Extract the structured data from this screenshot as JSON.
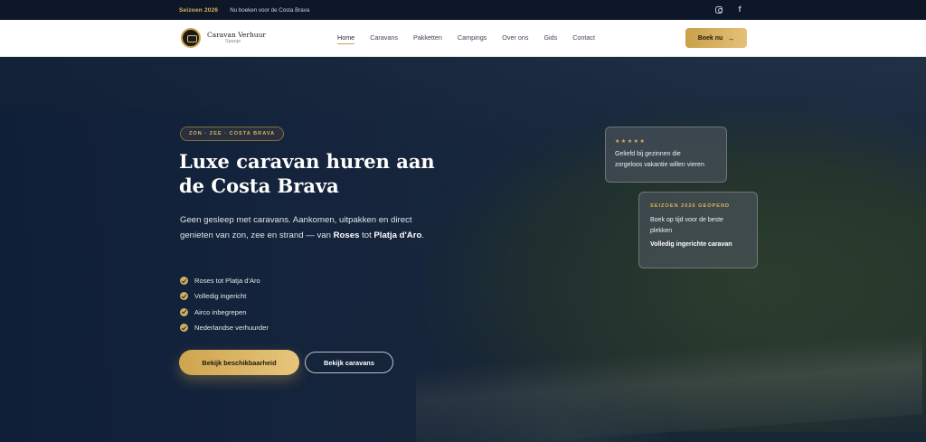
{
  "topbar": {
    "season": "Seizoen 2026",
    "notice": "Nu boeken voor de Costa Brava",
    "social": [
      {
        "icon": "instagram-icon"
      },
      {
        "icon": "facebook-icon",
        "glyph": "f"
      }
    ]
  },
  "header": {
    "logo": {
      "name": "Caravan Verhuur",
      "sub": "Spanje"
    },
    "nav": [
      "Home",
      "Caravans",
      "Pakketten",
      "Campings",
      "Over ons",
      "Gids",
      "Contact"
    ],
    "active_nav": "Home",
    "book_button": "Boek nu",
    "book_arrow": "→"
  },
  "hero": {
    "tag": "ZON · ZEE · COSTA BRAVA",
    "title": "Luxe caravan huren aan de Costa Brava",
    "intro_part1": "Geen gesleep met caravans. Aankomen, uitpakken en direct genieten van zon, zee en strand — van ",
    "intro_bold1": "Roses",
    "intro_part2": " tot ",
    "intro_bold2": "Platja d'Aro",
    "intro_part3": ".",
    "features": [
      "Roses tot Platja d'Aro",
      "Volledig ingericht",
      "Airco inbegrepen",
      "Nederlandse verhuurder"
    ],
    "primary_button": "Bekijk beschikbaarheid",
    "secondary_button": "Bekijk caravans"
  },
  "cards": {
    "review": {
      "stars": "★★★★★",
      "text": "Geliefd bij gezinnen die zorgeloos vakantie willen vieren"
    },
    "season": {
      "label": "SEIZOEN 2026 GEOPEND",
      "text": "Boek op tijd voor de beste plekken",
      "strong": "Volledig ingerichte caravan"
    }
  },
  "colors": {
    "accent": "#c9a24c",
    "navy": "#0d1728"
  }
}
